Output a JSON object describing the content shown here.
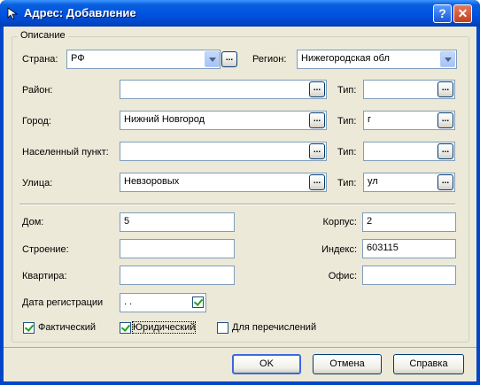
{
  "window": {
    "title": "Адрес: Добавление",
    "help_glyph": "?",
    "close_glyph": "✕"
  },
  "group": {
    "label": "Описание"
  },
  "country": {
    "label": "Страна:",
    "value": "РФ"
  },
  "region": {
    "label": "Регион:",
    "value": "Нижегородская обл"
  },
  "browse_label": "...",
  "rows": {
    "district": {
      "label": "Район:",
      "value": "",
      "type_label": "Тип:",
      "type_value": ""
    },
    "city": {
      "label": "Город:",
      "value": "Нижний Новгород",
      "type_label": "Тип:",
      "type_value": "г"
    },
    "locality": {
      "label": "Населенный пункт:",
      "value": "",
      "type_label": "Тип:",
      "type_value": ""
    },
    "street": {
      "label": "Улица:",
      "value": "Невзоровых",
      "type_label": "Тип:",
      "type_value": "ул"
    }
  },
  "house": {
    "label": "Дом:",
    "value": "5"
  },
  "building": {
    "label": "Строение:",
    "value": ""
  },
  "apartment": {
    "label": "Квартира:",
    "value": ""
  },
  "korpus": {
    "label": "Корпус:",
    "value": "2"
  },
  "index": {
    "label": "Индекс:",
    "value": "603115"
  },
  "office": {
    "label": "Офис:",
    "value": ""
  },
  "reg_date": {
    "label": "Дата регистрации",
    "value": " .  ."
  },
  "checkboxes": {
    "actual": {
      "label": "Фактический",
      "checked": true
    },
    "legal": {
      "label": "Юридический",
      "checked": true
    },
    "enum": {
      "label": "Для перечислений",
      "checked": false
    }
  },
  "buttons": {
    "ok": "OK",
    "cancel": "Отмена",
    "help": "Справка"
  }
}
